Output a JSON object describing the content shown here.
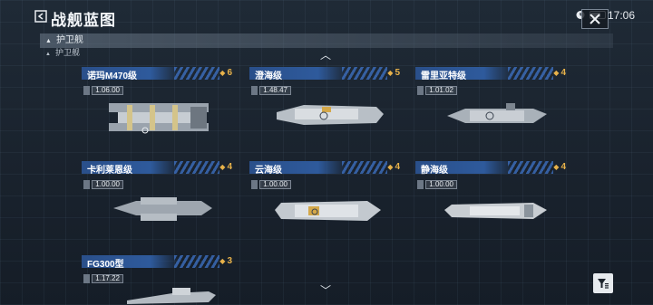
{
  "header": {
    "title": "战舰蓝图",
    "time": "17:06"
  },
  "section": {
    "label": "护卫舰",
    "sub_label": "护卫舰"
  },
  "cards": [
    {
      "name": "诺玛M470级",
      "stars": "6",
      "stat": "1.06.00"
    },
    {
      "name": "澄海级",
      "stars": "5",
      "stat": "1.48.47"
    },
    {
      "name": "雷里亚特级",
      "stars": "4",
      "stat": "1.01.02"
    },
    {
      "name": "卡利莱恩级",
      "stars": "4",
      "stat": "1.00.00"
    },
    {
      "name": "云海级",
      "stars": "4",
      "stat": "1.00.00"
    },
    {
      "name": "静海级",
      "stars": "4",
      "stat": "1.00.00"
    },
    {
      "name": "FG300型",
      "stars": "3",
      "stat": "1.17.22"
    }
  ],
  "colors": {
    "card_header": "#2e5a9c",
    "star": "#e8b24a",
    "background": "#1a232e"
  },
  "icons": {
    "back": "back-arrow-icon",
    "close": "close-icon",
    "filter": "filter-icon",
    "scroll_up": "chevron-up-icon",
    "scroll_down": "chevron-down-icon"
  }
}
